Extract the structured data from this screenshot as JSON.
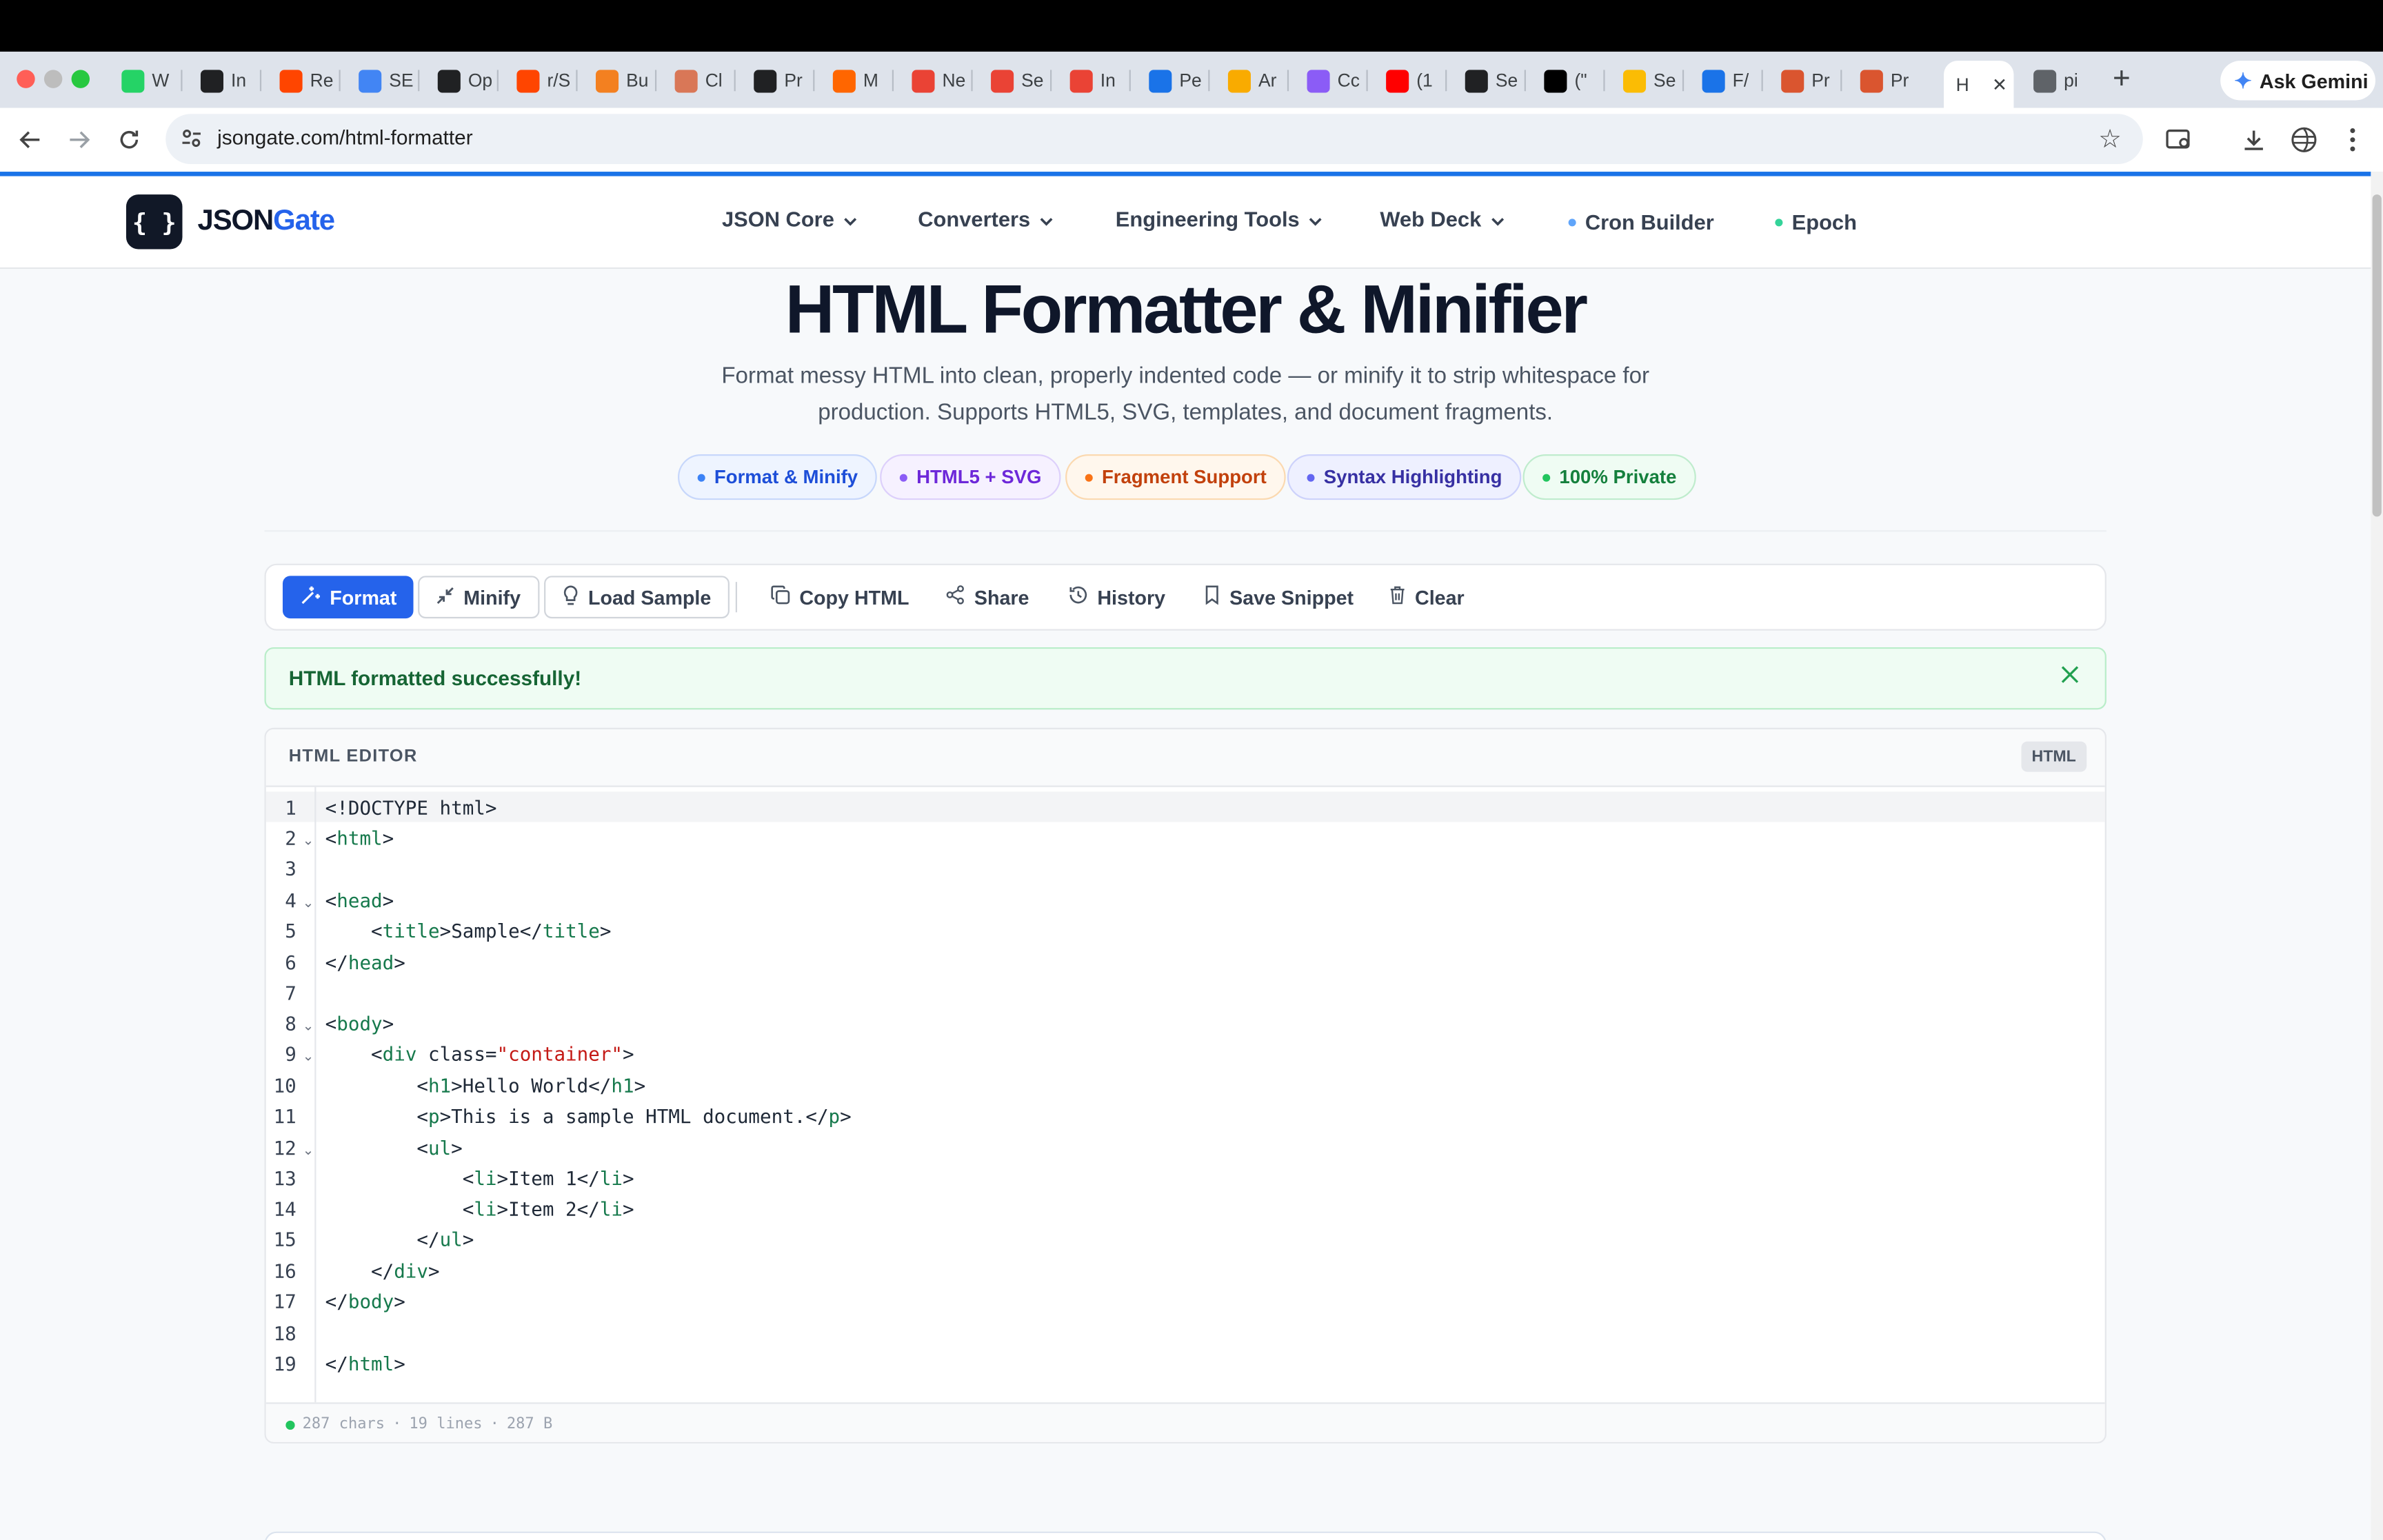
{
  "browser": {
    "tabs": [
      {
        "label": "W",
        "icon": "whatsapp-icon",
        "color": "#25d366"
      },
      {
        "label": "In",
        "icon": "openai-icon",
        "color": "#202123"
      },
      {
        "label": "Re",
        "icon": "reddit-icon",
        "color": "#ff4500"
      },
      {
        "label": "SE",
        "icon": "google-icon",
        "color": "#4285f4"
      },
      {
        "label": "Op",
        "icon": "openai-icon",
        "color": "#202123"
      },
      {
        "label": "r/S",
        "icon": "reddit-icon",
        "color": "#ff4500"
      },
      {
        "label": "Bu",
        "icon": "cloudflare-icon",
        "color": "#f38020"
      },
      {
        "label": "Cl",
        "icon": "claude-icon",
        "color": "#d97757"
      },
      {
        "label": "Pr",
        "icon": "openai-icon",
        "color": "#202123"
      },
      {
        "label": "M",
        "icon": "ycombinator-icon",
        "color": "#ff6600"
      },
      {
        "label": "Ne",
        "icon": "gmail-icon",
        "color": "#ea4335"
      },
      {
        "label": "Se",
        "icon": "gmail-icon",
        "color": "#ea4335"
      },
      {
        "label": "In",
        "icon": "gmail-icon",
        "color": "#ea4335"
      },
      {
        "label": "Pe",
        "icon": "analytics-icon",
        "color": "#1a73e8"
      },
      {
        "label": "Ar",
        "icon": "analytics-icon",
        "color": "#f9ab00"
      },
      {
        "label": "Cc",
        "icon": "vite-icon",
        "color": "#8b5cf6"
      },
      {
        "label": "(1",
        "icon": "youtube-icon",
        "color": "#ff0000"
      },
      {
        "label": "Se",
        "icon": "openai-icon",
        "color": "#202123"
      },
      {
        "label": "(\"",
        "icon": "x-icon",
        "color": "#000000"
      },
      {
        "label": "Se",
        "icon": "search-console-icon",
        "color": "#fbbc04"
      },
      {
        "label": "F/",
        "icon": "analytics-icon",
        "color": "#1a73e8"
      },
      {
        "label": "Pr",
        "icon": "producthunt-icon",
        "color": "#da552f"
      },
      {
        "label": "Pr",
        "icon": "producthunt-icon",
        "color": "#da552f"
      },
      {
        "label": "H",
        "icon": "active-tab",
        "color": "#ffffff"
      },
      {
        "label": "pi",
        "icon": "globe-icon",
        "color": "#5f6368"
      }
    ],
    "ask_gemini": "Ask Gemini",
    "url": "jsongate.com/html-formatter"
  },
  "site": {
    "logo_mark": "{ }",
    "logo_a": "JSON",
    "logo_b": "Gate",
    "nav": {
      "json_core": "JSON Core",
      "converters": "Converters",
      "engineering_tools": "Engineering Tools",
      "web_deck": "Web Deck",
      "cron_builder": "Cron Builder",
      "epoch": "Epoch"
    }
  },
  "hero": {
    "title": "HTML Formatter & Minifier",
    "subtitle_1": "Format messy HTML into clean, properly indented code — or minify it to strip whitespace for",
    "subtitle_2": "production. Supports HTML5, SVG, templates, and document fragments.",
    "badges": [
      "Format & Minify",
      "HTML5 + SVG",
      "Fragment Support",
      "Syntax Highlighting",
      "100% Private"
    ]
  },
  "actions": {
    "format": "Format",
    "minify": "Minify",
    "load_sample": "Load Sample",
    "copy_html": "Copy HTML",
    "share": "Share",
    "history": "History",
    "save_snippet": "Save Snippet",
    "clear": "Clear"
  },
  "alert": {
    "message": "HTML formatted successfully!"
  },
  "editor": {
    "title": "HTML EDITOR",
    "lang": "HTML",
    "line_numbers": [
      "1",
      "2",
      "3",
      "4",
      "5",
      "6",
      "7",
      "8",
      "9",
      "10",
      "11",
      "12",
      "13",
      "14",
      "15",
      "16",
      "17",
      "18",
      "19"
    ],
    "status": {
      "chars": "287 chars",
      "lines": "19 lines",
      "bytes": "287 B"
    }
  }
}
